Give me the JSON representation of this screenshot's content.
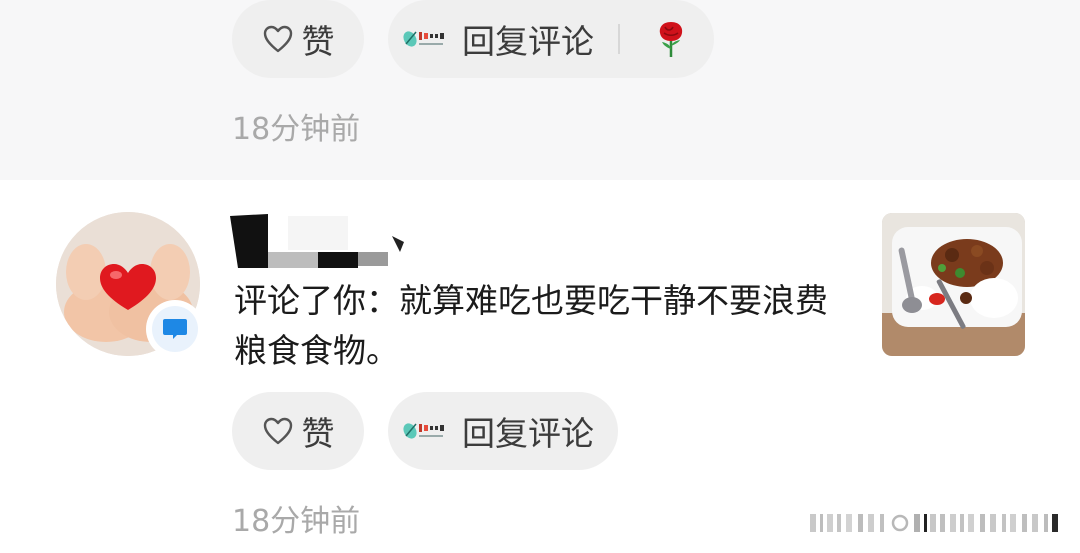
{
  "top_item": {
    "like_label": "赞",
    "reply_label": "回复评论",
    "time": "18分钟前"
  },
  "notification": {
    "comment_text": "评论了你：就算难吃也要吃干静不要浪费粮食食物。",
    "like_label": "赞",
    "reply_label": "回复评论",
    "time": "18分钟前"
  },
  "icons": {
    "like": "heart-outline-icon",
    "reply_badge": "app-badge-icon",
    "rose": "rose-emoji-icon",
    "message": "message-bubble-icon"
  },
  "colors": {
    "pill_bg": "#efefef",
    "time_text": "#a9a9a9",
    "top_bg": "#f7f7f8",
    "message_badge": "#1e88e5"
  }
}
